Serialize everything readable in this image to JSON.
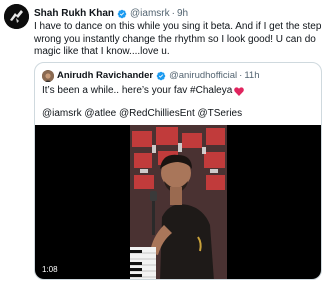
{
  "tweet": {
    "author_name": "Shah Rukh Khan",
    "handle": "@iamsrk",
    "separator": "·",
    "time": "9h",
    "text": "I have to dance on this while you sing it beta. And if I get the step wrong you instantly change the rhythm so I look good! U can do magic like that I know....love u."
  },
  "quoted_tweet": {
    "author_name": "Anirudh Ravichander",
    "handle": "@anirudhofficial",
    "separator": "·",
    "time": "11h",
    "text": "It’s been a while.. here’s your fav #Chaleya",
    "tags": "@iamsrk @atlee @RedChilliesEnt @TSeries",
    "video": {
      "duration": "1:08"
    }
  },
  "colors": {
    "verified": "#1d9bf0",
    "heart": "#e0245e",
    "text": "#0f1419",
    "muted": "#536471",
    "border": "#cfd9de"
  },
  "icons": [
    "verified-badge-icon",
    "heart-emoji-icon"
  ]
}
